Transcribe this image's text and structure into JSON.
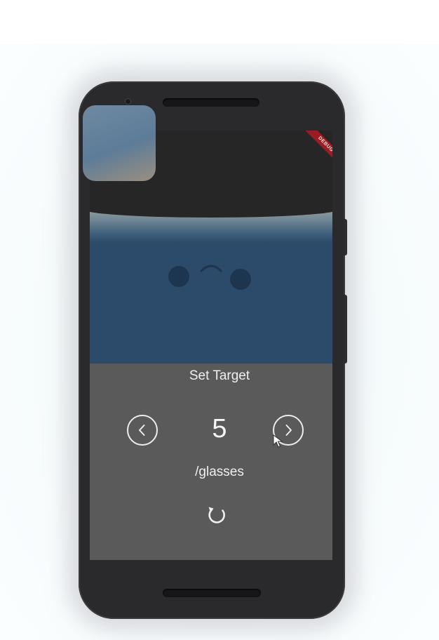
{
  "app": {
    "debug_banner": "DEBUG",
    "target_title": "Set Target",
    "glasses_count": "5",
    "unit_label": "/glasses"
  },
  "icons": {
    "prev": "chevron-left-circle-icon",
    "next": "chevron-right-circle-icon",
    "reset": "refresh-icon"
  },
  "colors": {
    "screen_bg": "#5a5a5a",
    "water": "#2c4a6a",
    "status_bar": "#262626",
    "debug_banner": "#9c1c24"
  }
}
